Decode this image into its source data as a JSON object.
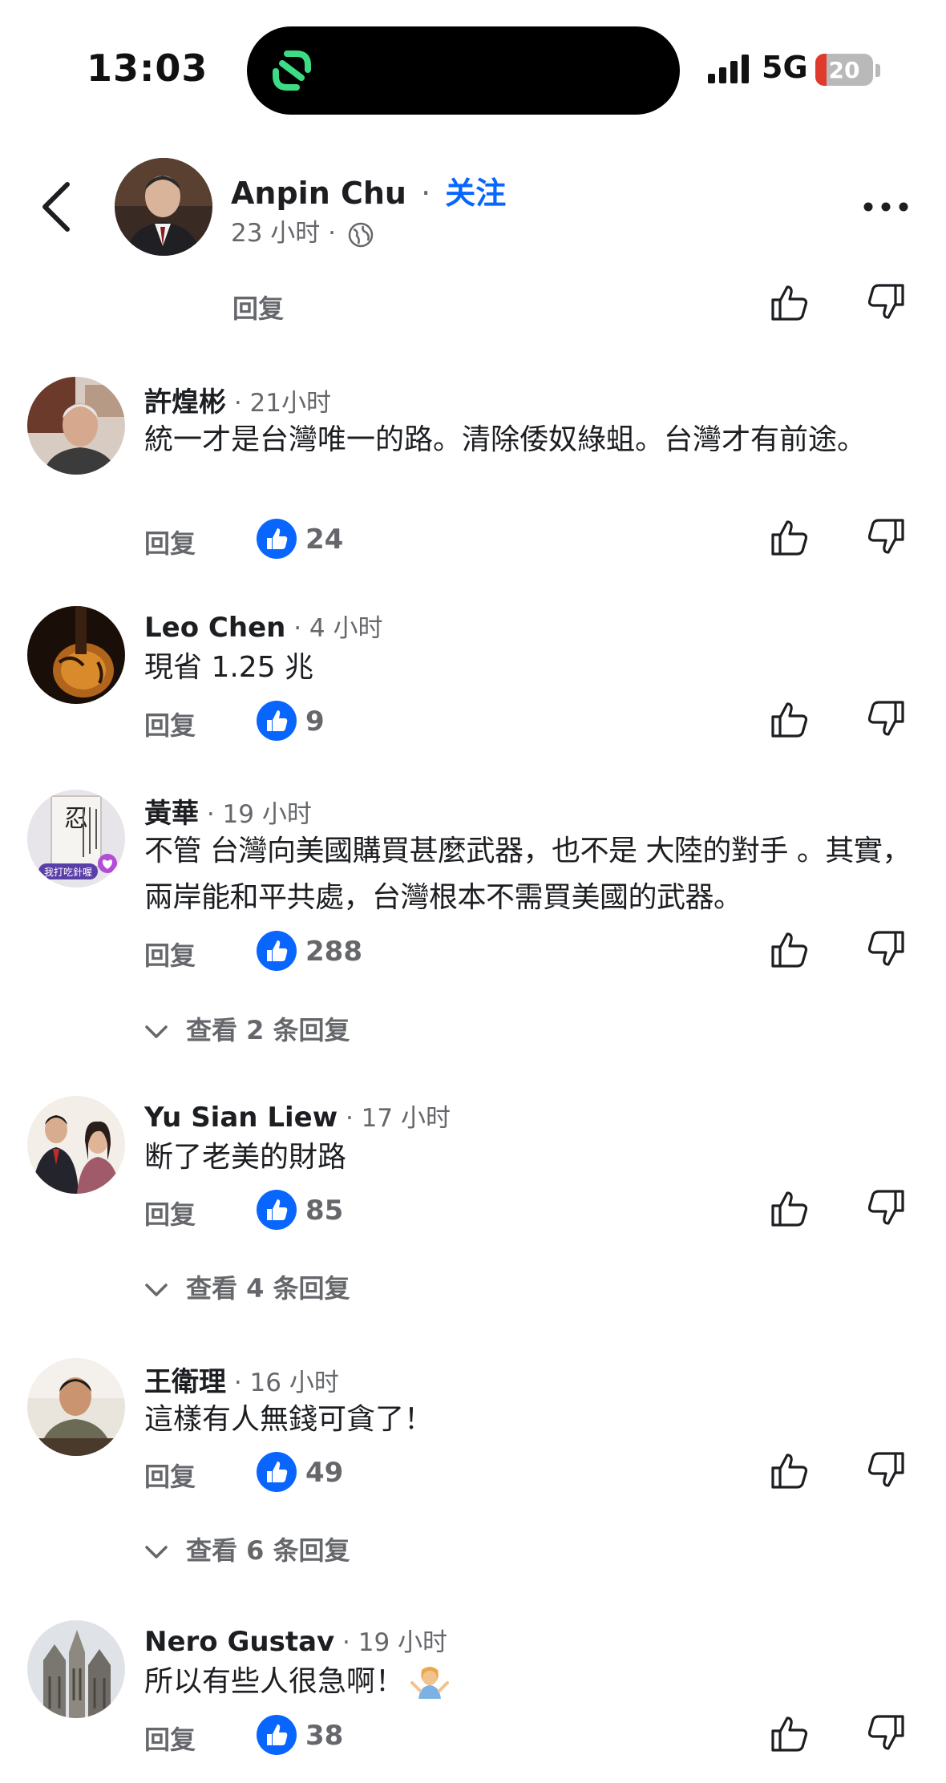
{
  "status": {
    "time": "13:03",
    "network": "5G",
    "battery": "20",
    "battery_level": 0.2
  },
  "header": {
    "name": "Anpin Chu",
    "separator": "·",
    "follow": "关注",
    "time": "23 小时 ·",
    "reply": "回复"
  },
  "comments": [
    {
      "name": "許煌彬",
      "time": " · 21小时",
      "text": "統一才是台灣唯一的路。清除倭奴綠蛆。台灣才有前途。",
      "reply": "回复",
      "likes": "24"
    },
    {
      "name": "Leo Chen",
      "time": " · 4 小时",
      "text": "現省 1.25 兆",
      "reply": "回复",
      "likes": "9"
    },
    {
      "name": "黃華",
      "time": " · 19 小时",
      "text": "不管 台灣向美國購買甚麼武器，也不是 大陸的對手 。其實，兩岸能和平共處，台灣根本不需買美國的武器。",
      "reply": "回复",
      "likes": "288",
      "view_replies": "查看 2 条回复"
    },
    {
      "name": "Yu Sian Liew",
      "time": " · 17 小时",
      "text": "断了老美的財路",
      "reply": "回复",
      "likes": "85",
      "view_replies": "查看 4 条回复"
    },
    {
      "name": "王衛理",
      "time": " · 16 小时",
      "text": "這樣有人無錢可貪了！",
      "reply": "回复",
      "likes": "49",
      "view_replies": "查看 6 条回复"
    },
    {
      "name": "Nero Gustav",
      "time": " · 19 小时",
      "text": "所以有些人很急啊！",
      "reply": "回复",
      "likes": "38"
    }
  ],
  "avatar_badge": "我打吃針喔"
}
